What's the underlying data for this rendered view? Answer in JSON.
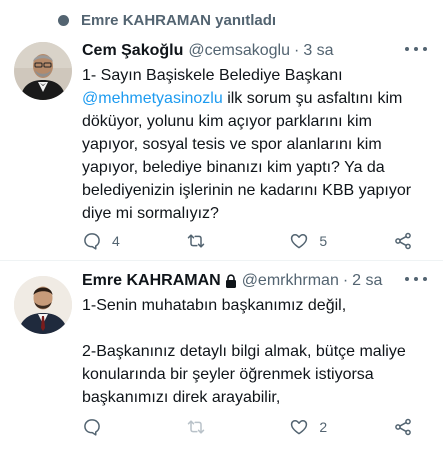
{
  "reply_context": {
    "text": "Emre KAHRAMAN yanıtladı"
  },
  "tweets": [
    {
      "name": "Cem Şakoğlu",
      "handle": "@cemsakoglu",
      "separator": "·",
      "time": "3 sa",
      "text_before": "1- Sayın Başiskele Belediye Başkanı ",
      "mention": "@mehmetyasinozlu",
      "text_after": " ilk sorum şu asfaltını kim döküyor, yolunu kim açıyor parklarını kim yapıyor, sosyal tesis ve spor alanlarını kim yapıyor, belediye binanızı kim yaptı? Ya da belediyenizin işlerinin ne kadarını KBB yapıyor diye mi sormalıyız?",
      "reply_count": "4",
      "retweet_count": "",
      "like_count": "5"
    },
    {
      "name": "Emre KAHRAMAN",
      "handle": "@emrkhrman",
      "separator": "·",
      "time": "2 sa",
      "paragraph1": "1-Senin muhatabın başkanımız değil,",
      "paragraph2": "2-Başkanınız detaylı bilgi almak, bütçe maliye konularında bir şeyler öğrenmek istiyorsa başkanımızı direk arayabilir,",
      "reply_count": "",
      "retweet_count": "",
      "like_count": "2"
    }
  ]
}
